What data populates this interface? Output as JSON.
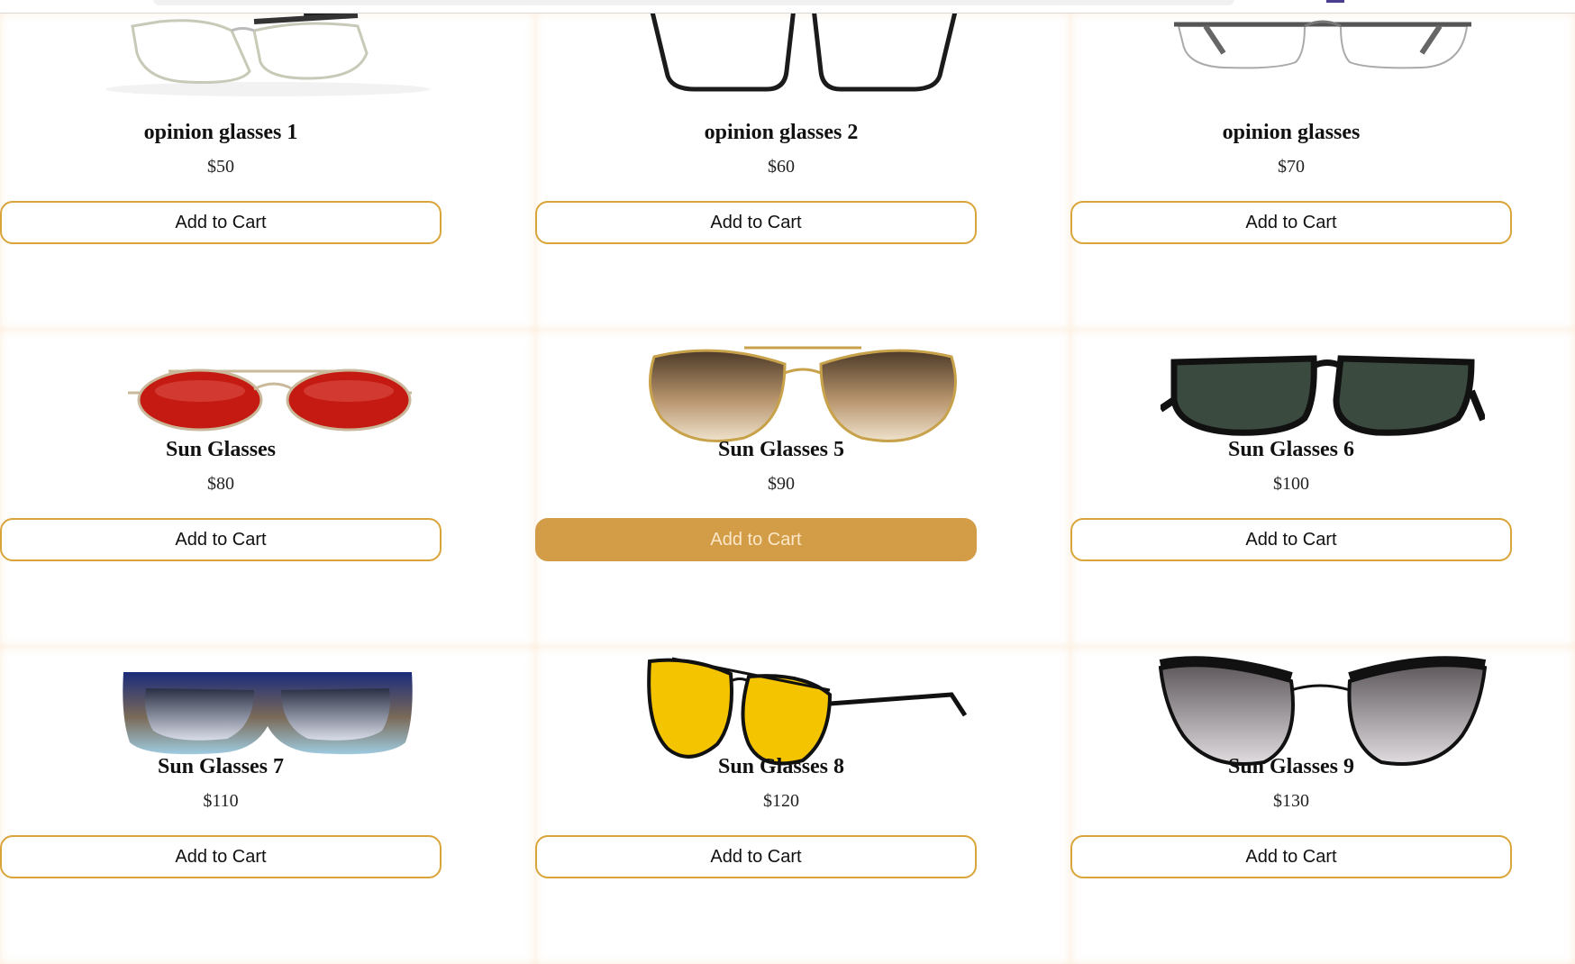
{
  "products": [
    {
      "name": "opinion glasses 1",
      "price": "$50",
      "button": "Add to Cart",
      "icon": "eyeglasses-silver-black-icon"
    },
    {
      "name": "opinion glasses 2",
      "price": "$60",
      "button": "Add to Cart",
      "icon": "eyeglasses-black-icon"
    },
    {
      "name": "opinion glasses",
      "price": "$70",
      "button": "Add to Cart",
      "icon": "eyeglasses-rimless-icon"
    },
    {
      "name": "Sun Glasses",
      "price": "$80",
      "button": "Add to Cart",
      "icon": "round-red-sunglasses-icon"
    },
    {
      "name": "Sun Glasses 5",
      "price": "$90",
      "button": "Add to Cart",
      "icon": "aviator-gold-sunglasses-icon"
    },
    {
      "name": "Sun Glasses 6",
      "price": "$100",
      "button": "Add to Cart",
      "icon": "black-wayfarer-sunglasses-icon"
    },
    {
      "name": "Sun Glasses 7",
      "price": "$110",
      "button": "Add to Cart",
      "icon": "blue-gradient-sunglasses-icon"
    },
    {
      "name": "Sun Glasses 8",
      "price": "$120",
      "button": "Add to Cart",
      "icon": "yellow-aviator-sunglasses-icon"
    },
    {
      "name": "Sun Glasses 9",
      "price": "$130",
      "button": "Add to Cart",
      "icon": "cat-eye-sunglasses-icon"
    }
  ],
  "hovered_button_index": 4,
  "colors": {
    "button_border": "#d9a53a",
    "button_hover_bg": "#d39d48",
    "button_hover_text": "#fbe7c8"
  }
}
